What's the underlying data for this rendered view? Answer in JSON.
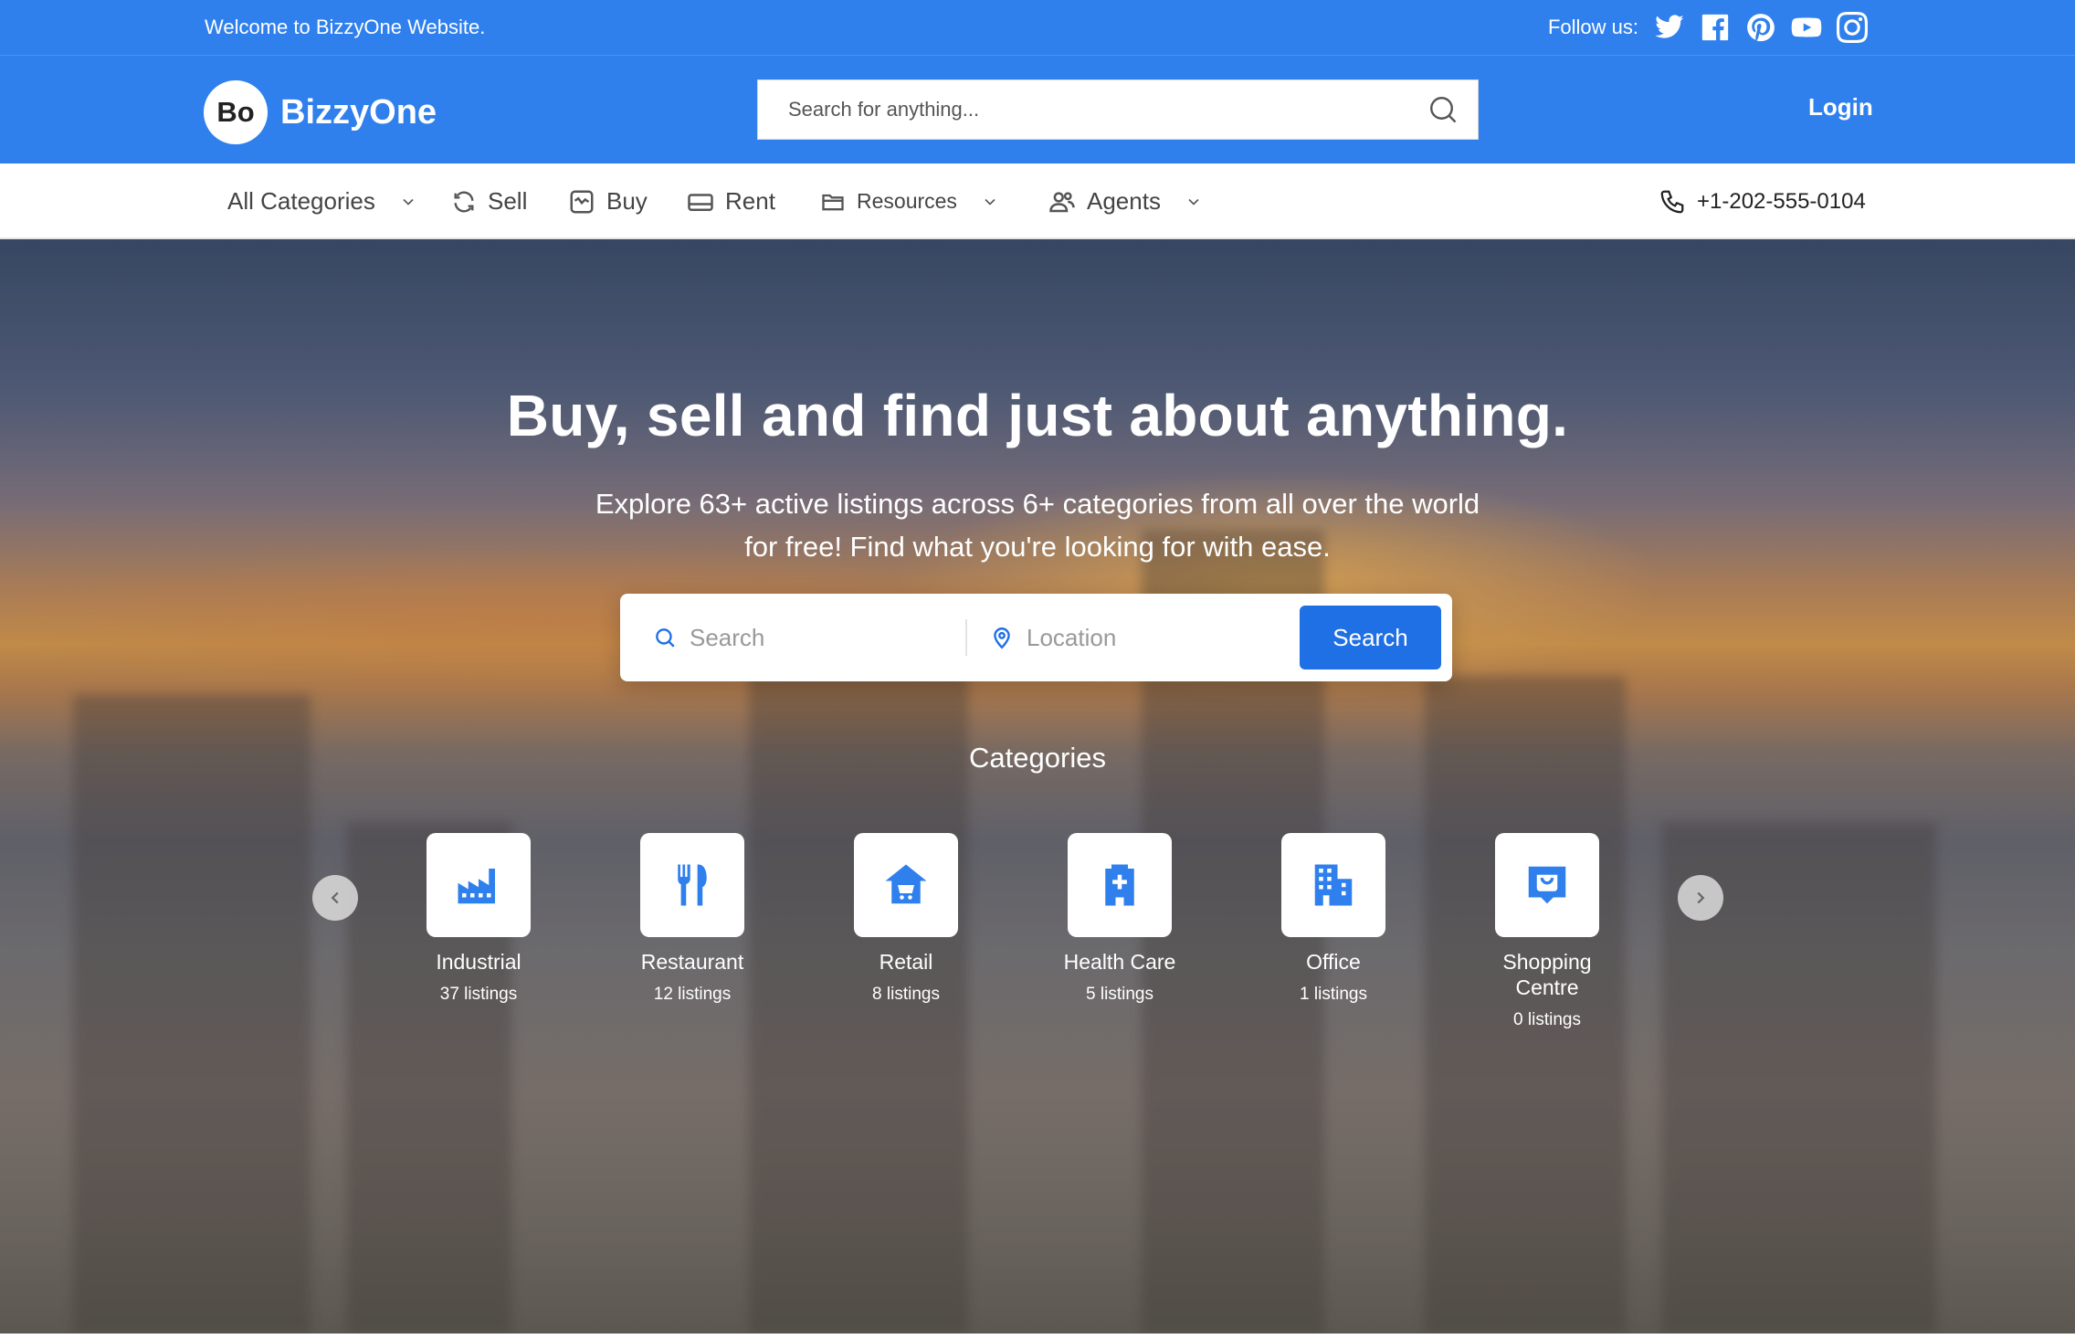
{
  "topbar": {
    "welcome": "Welcome to BizzyOne Website.",
    "follow_label": "Follow us:",
    "social": [
      "twitter-icon",
      "facebook-icon",
      "pinterest-icon",
      "youtube-icon",
      "instagram-icon"
    ]
  },
  "header": {
    "logo_mark": "Bo",
    "logo_text": "BizzyOne",
    "search_placeholder": "Search for anything...",
    "login_label": "Login"
  },
  "nav": {
    "all_categories": "All Categories",
    "sell": "Sell",
    "buy": "Buy",
    "rent": "Rent",
    "resources": "Resources",
    "agents": "Agents",
    "phone": "+1-202-555-0104"
  },
  "hero": {
    "title": "Buy, sell and find just about anything.",
    "subtitle": "Explore 63+ active listings across 6+ categories from all over the world for free! Find what you're looking for with ease.",
    "search_placeholder": "Search",
    "location_placeholder": "Location",
    "search_button": "Search",
    "categories_title": "Categories"
  },
  "categories": [
    {
      "name": "Industrial",
      "count": "37 listings",
      "icon": "factory-icon"
    },
    {
      "name": "Restaurant",
      "count": "12 listings",
      "icon": "cutlery-icon"
    },
    {
      "name": "Retail",
      "count": "8 listings",
      "icon": "shop-cart-icon"
    },
    {
      "name": "Health Care",
      "count": "5 listings",
      "icon": "hospital-icon"
    },
    {
      "name": "Office",
      "count": "1 listings",
      "icon": "office-building-icon"
    },
    {
      "name": "Shopping Centre",
      "count": "0 listings",
      "icon": "shopping-bag-icon"
    }
  ],
  "colors": {
    "brand": "#2f80ed",
    "button": "#1f6fe5",
    "text": "#444444"
  }
}
